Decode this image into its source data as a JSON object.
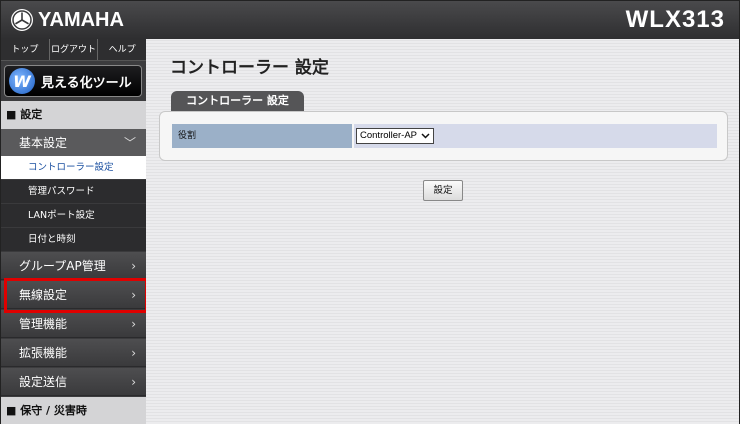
{
  "header": {
    "brand": "YAMAHA",
    "model": "WLX313"
  },
  "sidebar": {
    "topnav": [
      "トップ",
      "ログアウト",
      "ヘルプ"
    ],
    "visualize_button": "見える化ツール",
    "settings_header": "■ 設定",
    "basic_settings": "基本設定",
    "sub_items": [
      "コントローラー設定",
      "管理パスワード",
      "LANポート設定",
      "日付と時刻"
    ],
    "menu_items": [
      "グループAP管理",
      "無線設定",
      "管理機能",
      "拡張機能",
      "設定送信"
    ],
    "maintenance_header": "■ 保守 / 災害時",
    "chevron": "›",
    "chevron_open": "﹀"
  },
  "main": {
    "title": "コントローラー 設定",
    "tab": "コントローラー 設定",
    "role_label": "役割",
    "role_value": "Controller-AP",
    "submit_label": "設定"
  },
  "colors": {
    "highlight": "#e00000",
    "active_text": "#1a4fa0"
  }
}
